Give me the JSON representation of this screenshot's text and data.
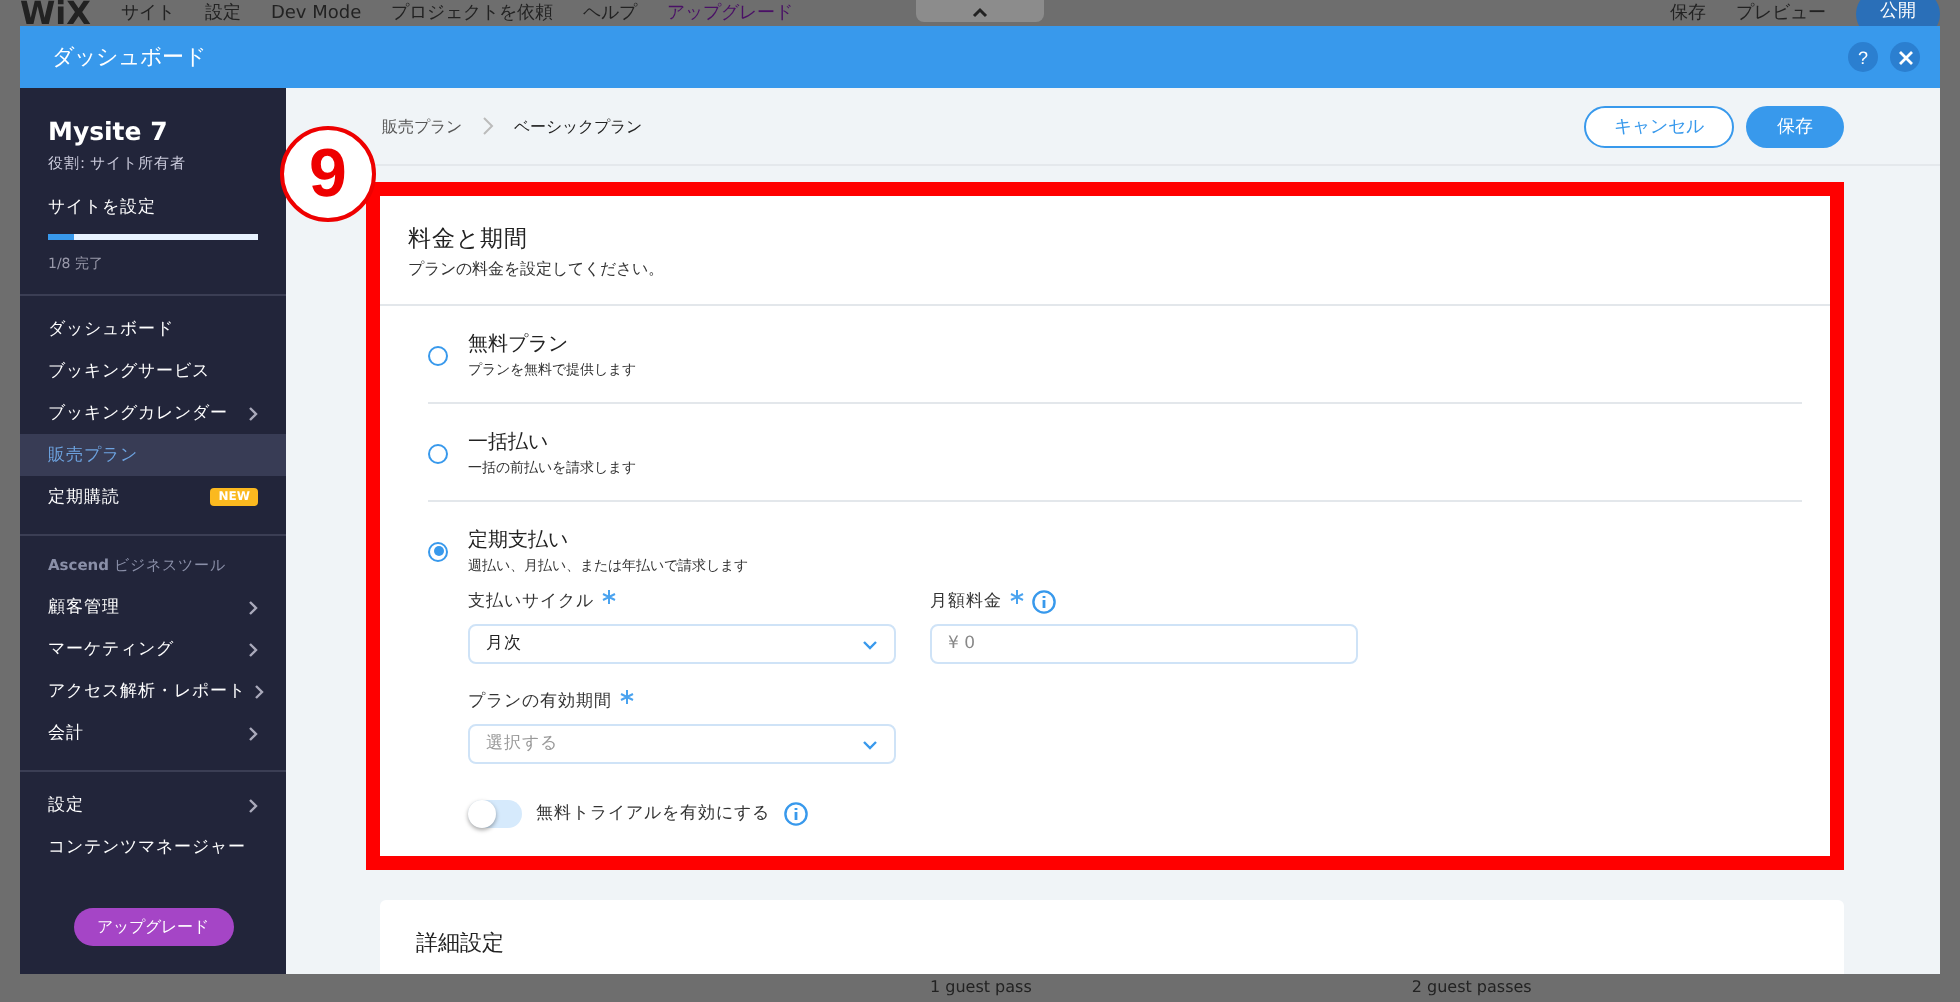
{
  "editor_bar": {
    "logo": "WiX",
    "menu": [
      "サイト",
      "設定",
      "Dev Mode",
      "プロジェクトを依頼",
      "ヘルプ"
    ],
    "upgrade": "アップグレード",
    "actions": [
      "保存",
      "プレビュー"
    ],
    "publish": "公開"
  },
  "dialog": {
    "title": "ダッシュボード",
    "help": "?"
  },
  "sidebar": {
    "site_name": "Mysite 7",
    "role": "役割: サイト所有者",
    "setup_label": "サイトを設定",
    "setup_progress": {
      "level": 0.12
    },
    "progress_text": "1/8 完了",
    "groups": [
      {
        "items": [
          {
            "label": "ダッシュボード",
            "selected": false,
            "arrow": false
          },
          {
            "label": "ブッキングサービス",
            "selected": false,
            "arrow": false
          },
          {
            "label": "ブッキングカレンダー",
            "selected": false,
            "arrow": true
          },
          {
            "label": "販売プラン",
            "selected": true,
            "arrow": false
          },
          {
            "label": "定期購読",
            "selected": false,
            "arrow": false,
            "badge": "NEW"
          }
        ]
      },
      {
        "heading": "**Ascend** ビジネスツール",
        "items": [
          {
            "label": "顧客管理",
            "selected": false,
            "arrow": true
          },
          {
            "label": "マーケティング",
            "selected": false,
            "arrow": true
          },
          {
            "label": "アクセス解析・レポート",
            "selected": false,
            "arrow": true
          },
          {
            "label": "会計",
            "selected": false,
            "arrow": true
          }
        ]
      },
      {
        "items": [
          {
            "label": "設定",
            "selected": false,
            "arrow": true
          },
          {
            "label": "コンテンツマネージャー",
            "selected": false,
            "arrow": false
          }
        ]
      }
    ],
    "upgrade_button": "アップグレード"
  },
  "breadcrumb": [
    "販売プラン",
    "ベーシックプラン"
  ],
  "buttons": {
    "cancel": "キャンセル",
    "save": "保存"
  },
  "annotation": "9",
  "pricing_card": {
    "title": "料金と期間",
    "subtitle": "プランの料金を設定してください。",
    "options": [
      {
        "title": "無料プラン",
        "description": "プランを無料で提供します",
        "selected": false
      },
      {
        "title": "一括払い",
        "description": "一括の前払いを請求します",
        "selected": false
      },
      {
        "title": "定期支払い",
        "description": "週払い、月払い、または年払いで請求します",
        "selected": true
      }
    ],
    "payment_cycle": {
      "label": "支払いサイクル",
      "value": "月次"
    },
    "monthly_price": {
      "label": "月額料金",
      "value": "¥ 0"
    },
    "duration": {
      "label": "プランの有効期間",
      "placeholder": "選択する"
    },
    "trial": {
      "label": "無料トライアルを有効にする",
      "on": false
    }
  },
  "details_card": {
    "title": "詳細設定"
  },
  "background_columns": [
    "1 guest pass",
    "2 guest passes"
  ]
}
